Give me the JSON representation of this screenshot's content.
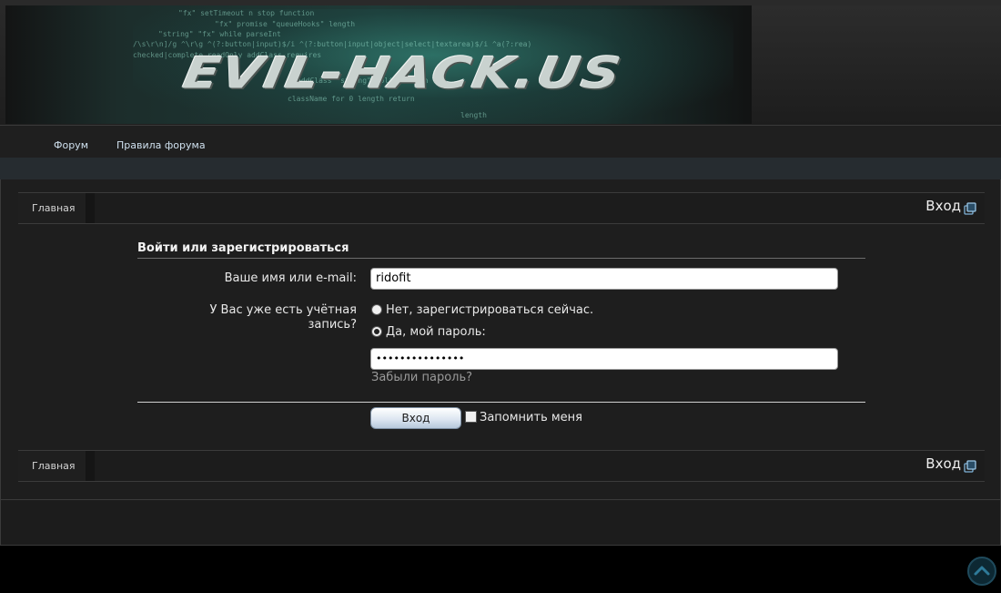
{
  "banner": {
    "logo_text": "EVIL-HACK.US",
    "code_lines": [
      "\"fx\"   setTimeout  n stop function",
      "\"fx\"   promise   \"queueHooks\"   length",
      "\"string\"   \"fx\" while   parseInt",
      "/\\s\\r\\n]/g  ^\\r\\g  ^(?:button|input)$/i  ^(?:button|input|object|select|textarea)$/i  ^a(?:rea)",
      "checked|complete  readOnly   addClass   requires",
      "addClass   \"string\"   split   length",
      "className   for   0   length   return",
      "length"
    ]
  },
  "nav": {
    "items": [
      {
        "label": "Форум"
      },
      {
        "label": "Правила форума"
      }
    ]
  },
  "breadcrumb": {
    "home_label": "Главная"
  },
  "page": {
    "title": "Вход"
  },
  "form": {
    "title": "Войти или зарегистрироваться",
    "login_label": "Ваше имя или e-mail:",
    "login_value": "ridofit",
    "account_label_line1": "У Вас уже есть учётная",
    "account_label_line2": "запись?",
    "radio_no_label": "Нет, зарегистрироваться сейчас.",
    "radio_yes_label": "Да, мой пароль:",
    "password_value": "•••••••••••••••",
    "forgot_label": "Забыли пароль?",
    "submit_label": "Вход",
    "remember_label": "Запомнить меня"
  },
  "colors": {
    "accent": "#cfe0ee",
    "background": "#1e1e1e",
    "link_muted": "#9a9a9a"
  },
  "icons": {
    "title_icon": "external-window-icon",
    "scroll_top": "chevron-up-icon"
  }
}
